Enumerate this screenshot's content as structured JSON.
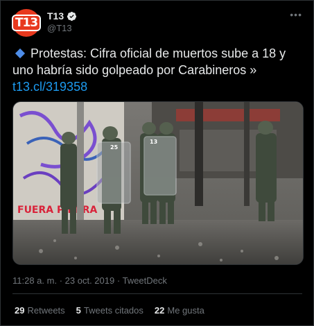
{
  "account": {
    "display_name": "T13",
    "handle": "@T13",
    "avatar_text": "T13",
    "verified_icon": "verified-badge-icon"
  },
  "tweet": {
    "headline": "Protestas: Cifra oficial de muertos sube a 18 y uno habría sido golpeado por Carabineros »",
    "link": "t13.cl/319358",
    "bullet_icon": "blue-diamond-icon",
    "media_description_icon": "photo-icon",
    "shield_numbers": [
      "13",
      "25"
    ],
    "wall_graffiti": "FUERA PIÑERA"
  },
  "meta": {
    "time": "11:28 a. m.",
    "separator": "·",
    "date": "23 oct. 2019",
    "source": "TweetDeck"
  },
  "stats": {
    "retweets_count": "29",
    "retweets_label": "Retweets",
    "quotes_count": "5",
    "quotes_label": "Tweets citados",
    "likes_count": "22",
    "likes_label": "Me gusta"
  },
  "colors": {
    "background": "#000000",
    "link": "#1d9bf0",
    "avatar": "#e8391e",
    "muted": "#71767b"
  }
}
